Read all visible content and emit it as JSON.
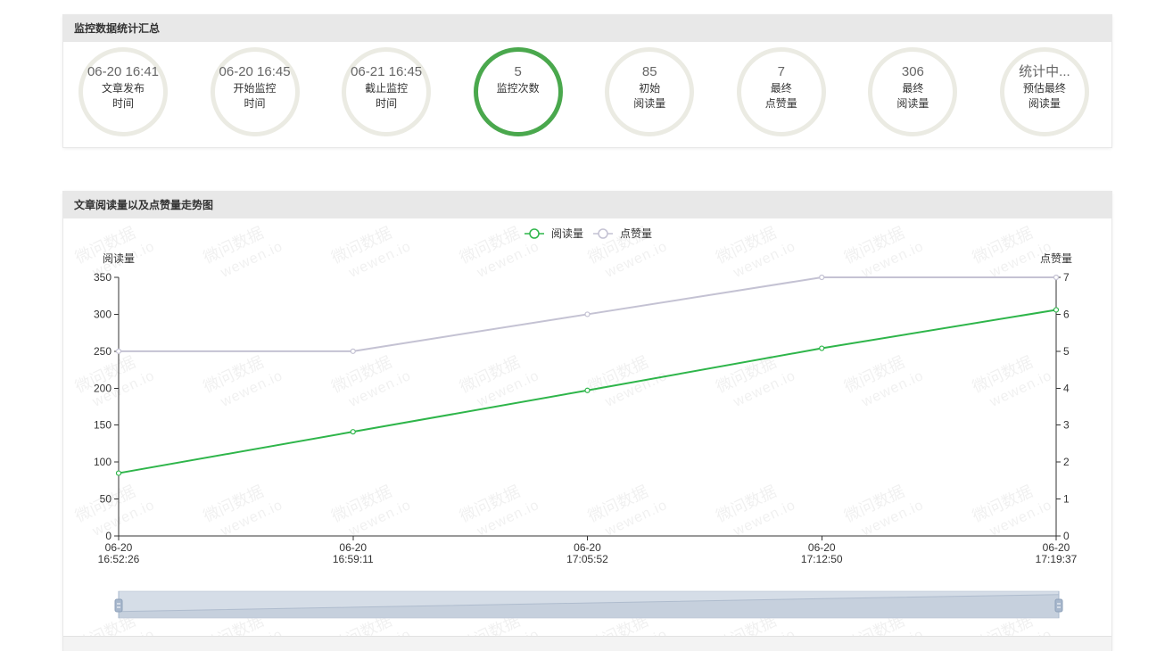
{
  "summary": {
    "title": "监控数据统计汇总",
    "items": [
      {
        "value": "06-20 16:41",
        "label1": "文章发布",
        "label2": "时间"
      },
      {
        "value": "06-20 16:45",
        "label1": "开始监控",
        "label2": "时间"
      },
      {
        "value": "06-21 16:45",
        "label1": "截止监控",
        "label2": "时间"
      },
      {
        "value": "5",
        "label1": "监控次数"
      },
      {
        "value": "85",
        "label1": "初始",
        "label2": "阅读量"
      },
      {
        "value": "7",
        "label1": "最终",
        "label2": "点赞量"
      },
      {
        "value": "306",
        "label1": "最终",
        "label2": "阅读量"
      },
      {
        "value": "统计中...",
        "label1": "预估最终",
        "label2": "阅读量"
      }
    ]
  },
  "theme": {
    "ring": "#ebebe3",
    "ring_active": "#4aa84d",
    "header_bg": "#e8e8e8"
  },
  "watermark": {
    "line1": "微问数据",
    "line2": "wewen.io"
  },
  "chart_data": {
    "type": "line",
    "title": "文章阅读量以及点赞量走势图",
    "categories": [
      "06-20 16:52:26",
      "06-20 16:59:11",
      "06-20 17:05:52",
      "06-20 17:12:50",
      "06-20 17:19:37"
    ],
    "series": [
      {
        "name": "阅读量",
        "axis": "left",
        "color": "#2eb54a",
        "values": [
          85,
          141,
          197,
          254,
          306
        ]
      },
      {
        "name": "点赞量",
        "axis": "right",
        "color": "#c4c2d3",
        "values": [
          5,
          5,
          6,
          7,
          7
        ]
      }
    ],
    "ylabel": "阅读量",
    "ylabel_right": "点赞量",
    "ylim": [
      0,
      350
    ],
    "ylim_right": [
      0,
      7
    ],
    "yticks": [
      0,
      50,
      100,
      150,
      200,
      250,
      300,
      350
    ],
    "yticks_right": [
      0,
      1,
      2,
      3,
      4,
      5,
      6,
      7
    ],
    "grid": false,
    "legend": "top-center",
    "datazoom": {
      "start": 0,
      "end": 100
    }
  }
}
